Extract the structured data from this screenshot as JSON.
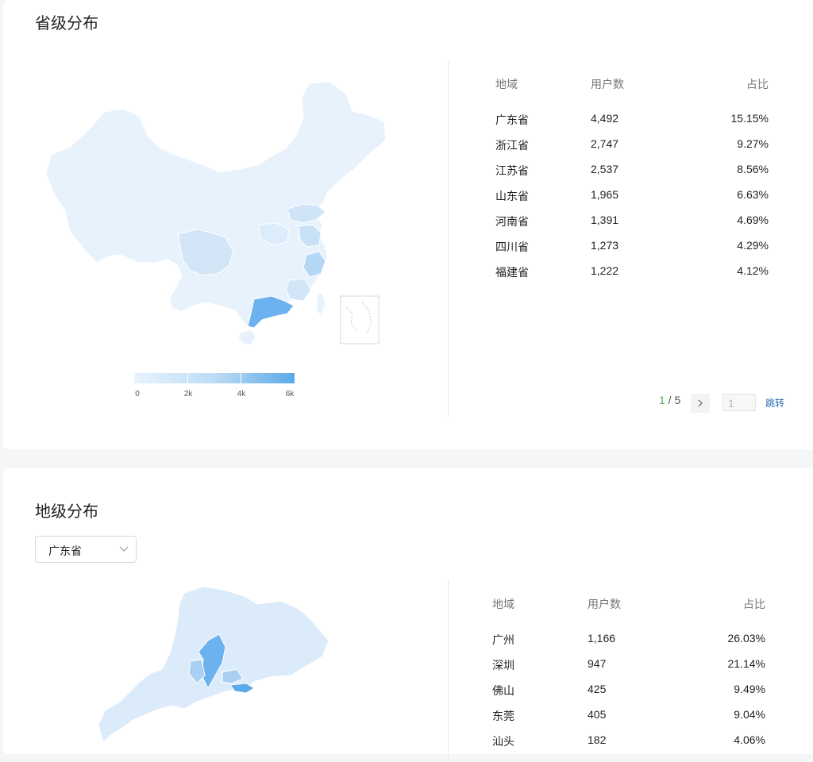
{
  "province": {
    "title": "省级分布",
    "legend_ticks": [
      "0",
      "2k",
      "4k",
      "6k"
    ],
    "table": {
      "headers": {
        "region": "地域",
        "users": "用户数",
        "pct": "占比"
      },
      "rows": [
        {
          "region": "广东省",
          "users": "4,492",
          "pct": "15.15%"
        },
        {
          "region": "浙江省",
          "users": "2,747",
          "pct": "9.27%"
        },
        {
          "region": "江苏省",
          "users": "2,537",
          "pct": "8.56%"
        },
        {
          "region": "山东省",
          "users": "1,965",
          "pct": "6.63%"
        },
        {
          "region": "河南省",
          "users": "1,391",
          "pct": "4.69%"
        },
        {
          "region": "四川省",
          "users": "1,273",
          "pct": "4.29%"
        },
        {
          "region": "福建省",
          "users": "1,222",
          "pct": "4.12%"
        }
      ]
    },
    "pager": {
      "current": "1",
      "sep": " / ",
      "total": "5",
      "next_icon": "chevron-right-icon",
      "jump_placeholder": "1",
      "jump_label": "跳转"
    }
  },
  "city": {
    "title": "地级分布",
    "select": {
      "value": "广东省",
      "arrow_icon": "chevron-down-icon"
    },
    "table": {
      "headers": {
        "region": "地域",
        "users": "用户数",
        "pct": "占比"
      },
      "rows": [
        {
          "region": "广州",
          "users": "1,166",
          "pct": "26.03%"
        },
        {
          "region": "深圳",
          "users": "947",
          "pct": "21.14%"
        },
        {
          "region": "佛山",
          "users": "425",
          "pct": "9.49%"
        },
        {
          "region": "东莞",
          "users": "405",
          "pct": "9.04%"
        },
        {
          "region": "汕头",
          "users": "182",
          "pct": "4.06%"
        }
      ]
    }
  },
  "colors": {
    "map_base": "#e8f2fc",
    "map_mid": "#cfe4f7",
    "map_high": "#6cb2ee",
    "map_highest": "#5aa9e8",
    "map_stroke": "#ffffff",
    "pager_current": "#4caf50",
    "jump_link": "#2d6cb5"
  }
}
